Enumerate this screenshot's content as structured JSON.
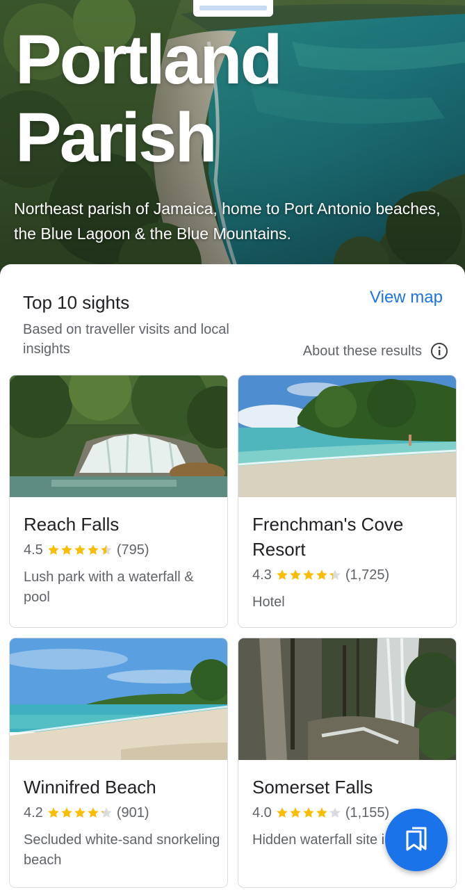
{
  "hero": {
    "title": "Portland Parish",
    "description": "Northeast parish of Jamaica, home to Port Antonio beaches, the Blue Lagoon & the Blue Mountains."
  },
  "section": {
    "title": "Top 10 sights",
    "view_map_label": "View map",
    "subtitle": "Based on traveller visits and local insights",
    "about_label": "About these results",
    "about_icon": "info-icon"
  },
  "sights": [
    {
      "name": "Reach Falls",
      "rating": "4.5",
      "rating_value": 4.5,
      "reviews": "(795)",
      "description": "Lush park with a waterfall & pool"
    },
    {
      "name": "Frenchman's Cove Resort",
      "rating": "4.3",
      "rating_value": 4.3,
      "reviews": "(1,725)",
      "description": "Hotel"
    },
    {
      "name": "Winnifred Beach",
      "rating": "4.2",
      "rating_value": 4.2,
      "reviews": "(901)",
      "description": "Secluded white-sand snorkeling beach"
    },
    {
      "name": "Somerset Falls",
      "rating": "4.0",
      "rating_value": 4.0,
      "reviews": "(1,155)",
      "description": "Hidden waterfall site in a gorge"
    }
  ],
  "colors": {
    "accent": "#1a73e8",
    "star_filled": "#fbbc04",
    "star_empty": "#dadce0",
    "text_primary": "#202124",
    "text_secondary": "#5f6368"
  },
  "fab": {
    "icon": "bookmarks-icon"
  }
}
